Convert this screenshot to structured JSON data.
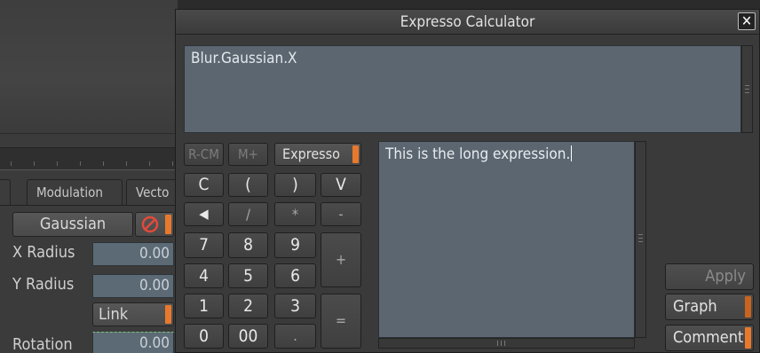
{
  "background_panel": {
    "tabs": [
      {
        "label": ""
      },
      {
        "label": "Modulation"
      },
      {
        "label": "Vecto"
      }
    ],
    "filter_button": "Gaussian",
    "x_radius": {
      "label": "X Radius",
      "value": "0.00"
    },
    "y_radius": {
      "label": "Y Radius",
      "value": "0.00"
    },
    "link_button": "Link",
    "rotation": {
      "label": "Rotation",
      "value": "0.00"
    }
  },
  "calculator": {
    "title": "Expresso Calculator",
    "close_glyph": "✕",
    "expression": "Blur.Gaussian.X",
    "comment": "This is the long expression.",
    "keys": {
      "rcm": "R-CM",
      "mplus": "M+",
      "expresso": "Expresso",
      "c": "C",
      "lparen": "(",
      "rparen": ")",
      "v": "V",
      "back": "◀",
      "divide": "/",
      "multiply": "*",
      "minus": "-",
      "seven": "7",
      "eight": "8",
      "nine": "9",
      "plus": "+",
      "four": "4",
      "five": "5",
      "six": "6",
      "one": "1",
      "two": "2",
      "three": "3",
      "equals": "=",
      "zero": "0",
      "double_zero": "00",
      "dot": "."
    },
    "side_buttons": {
      "apply": "Apply",
      "graph": "Graph",
      "comment": "Comment"
    },
    "colors": {
      "accent": "#e8792c",
      "field_bg": "#5b6670"
    }
  }
}
